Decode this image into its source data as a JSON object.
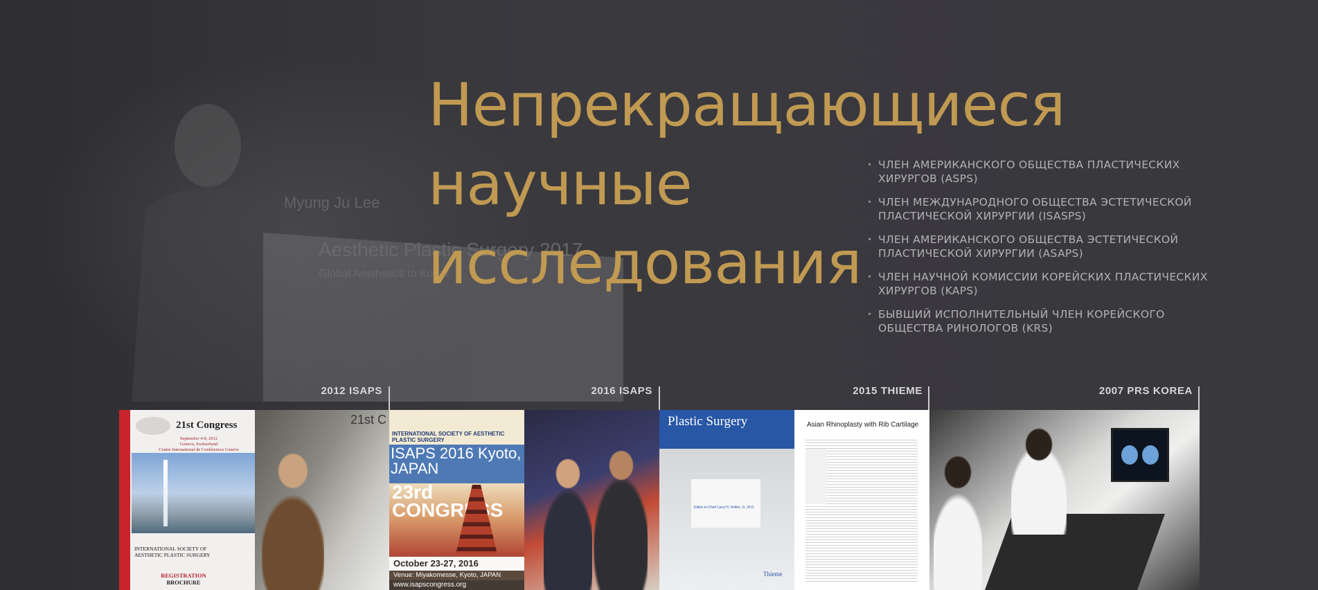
{
  "hero": {
    "title_lines": [
      "Непрекращающиеся",
      "научные",
      "исследования"
    ],
    "background_sign": {
      "name": "Myung Ju Lee",
      "event": "Aesthetic Plastic Surgery 2017",
      "tagline": "Global Aesthetics to Korea"
    }
  },
  "memberships": [
    "ЧЛЕН АМЕРИКАНСКОГО ОБЩЕСТВА ПЛАСТИЧЕСКИХ ХИРУРГОВ (ASPS)",
    "ЧЛЕН МЕЖДУНАРОДНОГО ОБЩЕСТВА ЭСТЕТИЧЕСКОЙ ПЛАСТИЧЕСКОЙ ХИРУРГИИ (ISASPS)",
    "ЧЛЕН АМЕРИКАНСКОГО ОБЩЕСТВА ЭСТЕТИЧЕСКОЙ ПЛАСТИЧЕСКОЙ ХИРУРГИИ (ASAPS)",
    "ЧЛЕН НАУЧНОЙ КОМИССИИ КОРЕЙСКИХ ПЛАСТИЧЕСКИХ ХИРУРГОВ (KAPS)",
    "БЫВШИЙ ИСПОЛНИТЕЛЬНЫЙ ЧЛЕН КОРЕЙСКОГО ОБЩЕСТВА РИНОЛОГОВ (KRS)"
  ],
  "timeline": [
    {
      "label": "2012 ISAPS"
    },
    {
      "label": "2016 ISAPS"
    },
    {
      "label": "2015 THIEME"
    },
    {
      "label": "2007 PRS KOREA"
    }
  ],
  "brochure": {
    "congress": "21st Congress",
    "dates": "September 4-8, 2012",
    "place": "Geneva, Switzerland",
    "centre": "Centre International de Conférences Genève",
    "society": "INTERNATIONAL SOCIETY OF AESTHETIC PLASTIC SURGERY",
    "registration": "REGISTRATION",
    "brochure_word": "BROCHURE"
  },
  "photo1": {
    "backdrop": "21st C"
  },
  "poster": {
    "society": "INTERNATIONAL SOCIETY OF AESTHETIC PLASTIC SURGERY",
    "headline": "ISAPS 2016 Kyoto, JAPAN",
    "number": "23rd CONGRESS",
    "date": "October 23-27, 2016",
    "venue": "Venue: Miyakomesse, Kyoto, JAPAN",
    "url": "www.isapscongress.org"
  },
  "journal": {
    "title": "Plastic Surgery",
    "editor": "Editor-in-Chief Larry H. Hollier, Jr., M.D.",
    "publisher": "Thieme"
  },
  "article": {
    "title": "Asian Rhinoplasty with Rib Cartilage"
  }
}
